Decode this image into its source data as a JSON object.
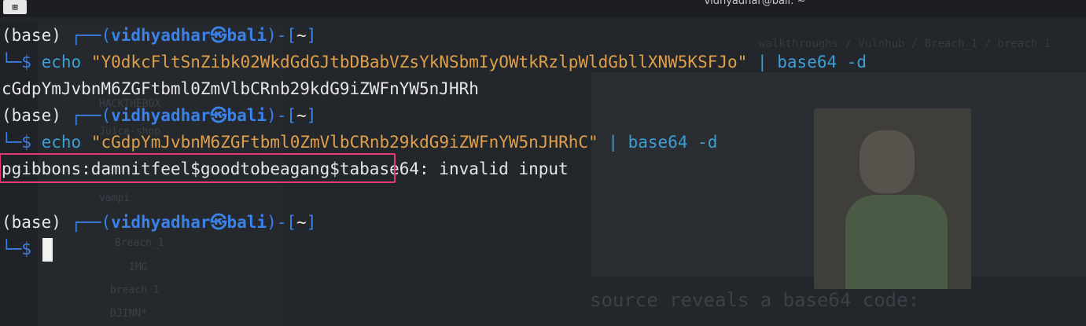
{
  "window": {
    "title": "vidhyadhar@bali: ~"
  },
  "background": {
    "tree_items": [
      "HACKTHEBOX",
      "Juice-shop",
      "vampi",
      "Breach_1",
      "IMG",
      "breach 1",
      "DJINN*"
    ],
    "breadcrumb": "walkthroughs / Vulnhub / Breach_1 / breach 1",
    "caption": "source reveals a base64 code:"
  },
  "terminal": {
    "prompt": {
      "env": "(base)",
      "corner_top": "┌──(",
      "user": "vidhyadhar",
      "host_sep": "㉿",
      "host": "bali",
      "dir_prefix": ")-[",
      "dir": "~",
      "dir_suffix": "]",
      "corner_bottom": "└─",
      "symbol": "$"
    },
    "cmd1": {
      "command": "echo",
      "argument": "\"Y0dkcFltSnZibk02WkdGdGJtbDBabVZsYkNSbmIyOWtkRzlpWldGbllXNW5KSFJo\"",
      "pipe": "|",
      "pipe_command": "base64 -d"
    },
    "output1": "cGdpYmJvbnM6ZGFtbml0ZmVlbCRnb29kdG9iZWFnYW5nJHRh",
    "cmd2": {
      "command": "echo",
      "argument": "\"cGdpYmJvbnM6ZGFtbml0ZmVlbCRnb29kdG9iZWFnYW5nJHRhC\"",
      "pipe": "|",
      "pipe_command": "base64 -d"
    },
    "output2": {
      "decoded": "pgibbons:damnitfeel$goodtobeagang$ta",
      "error": "base64: invalid input"
    }
  },
  "colors": {
    "accent_blue": "#3b82e8",
    "string_orange": "#e0a04a",
    "highlight_pink": "#e23a7a"
  }
}
